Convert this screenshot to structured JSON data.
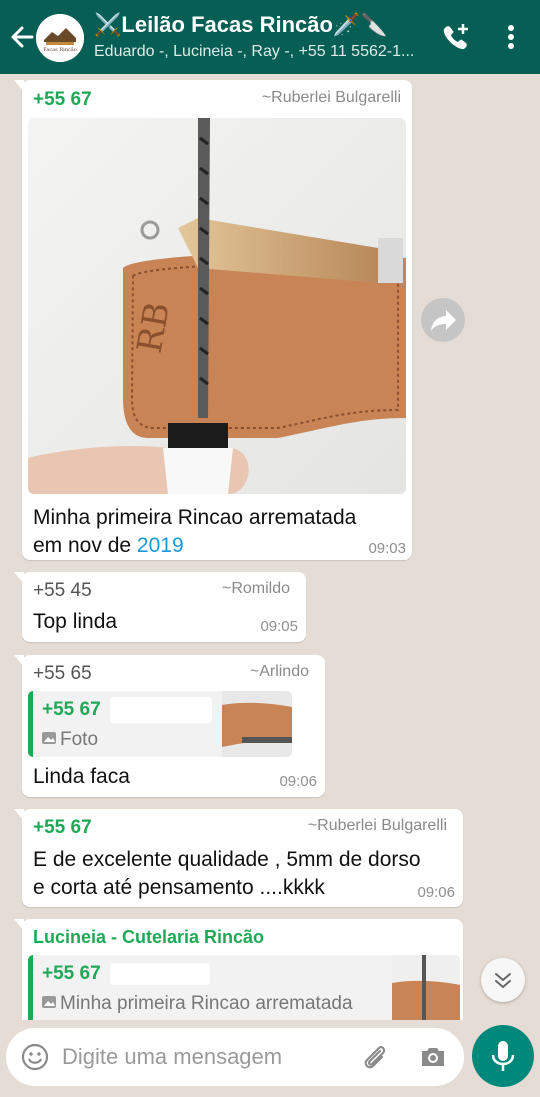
{
  "header": {
    "title": "⚔️Leilão Facas Rincão🗡️🔪",
    "subtitle": "Eduardo -, Lucineia -, Ray -, +55 11 5562-1..."
  },
  "messages": [
    {
      "sender": "+55 67",
      "alias": "~Ruberlei Bulgarelli",
      "text_line1": "Minha primeira Rincao arrematada",
      "text_line2_prefix": "em nov de ",
      "text_line2_link": "2019",
      "time": "09:03"
    },
    {
      "sender": "+55 45",
      "alias": "~Romildo",
      "text": "Top linda",
      "time": "09:05"
    },
    {
      "sender": "+55 65",
      "alias": "~Arlindo",
      "quote_name": "+55 67",
      "quote_text": "Foto",
      "text": "Linda faca",
      "time": "09:06"
    },
    {
      "sender": "+55 67",
      "alias": "~Ruberlei Bulgarelli",
      "text_line1": "E de excelente qualidade , 5mm de dorso",
      "text_line2": "e corta até pensamento ....kkkk",
      "time": "09:06"
    },
    {
      "sender": "Lucineia - Cutelaria Rincão",
      "quote_name": "+55 67",
      "quote_text": "Minha primeira Rincao arrematada"
    }
  ],
  "input": {
    "placeholder": "Digite uma mensagem"
  },
  "colors": {
    "header": "#075e54",
    "background": "#e5ddd5",
    "sender_green": "#1fa855",
    "mic_button": "#00897b",
    "link": "#1a9ad6"
  }
}
